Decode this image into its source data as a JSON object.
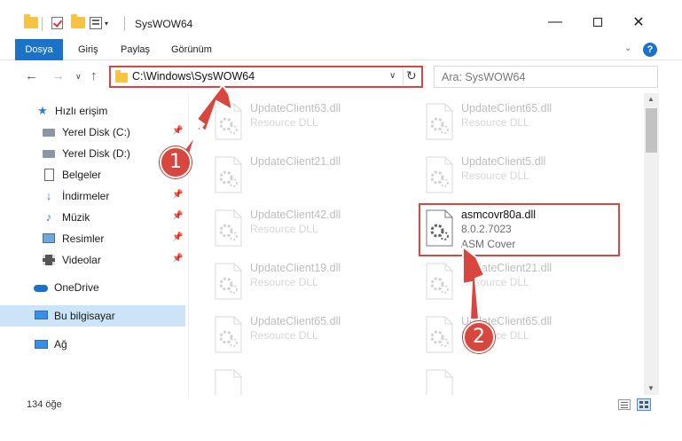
{
  "window": {
    "title": "SysWOW64",
    "minimize_icon": "minimize-icon",
    "maximize_icon": "maximize-icon",
    "close_icon": "close-icon"
  },
  "ribbon": {
    "tabs": [
      {
        "label": "Dosya",
        "active": true
      },
      {
        "label": "Giriş"
      },
      {
        "label": "Paylaş"
      },
      {
        "label": "Görünüm"
      }
    ],
    "help_label": "?"
  },
  "address": {
    "path": "C:\\Windows\\SysWOW64",
    "search_placeholder": "Ara: SysWOW64"
  },
  "sidebar": {
    "items": [
      {
        "label": "Hızlı erişim",
        "icon": "star-icon"
      },
      {
        "label": "Yerel Disk (C:)",
        "icon": "drive-icon",
        "pinned": true
      },
      {
        "label": "Yerel Disk (D:)",
        "icon": "drive-icon"
      },
      {
        "label": "Belgeler",
        "icon": "document-icon"
      },
      {
        "label": "İndirmeler",
        "icon": "download-icon",
        "pinned": true
      },
      {
        "label": "Müzik",
        "icon": "music-icon",
        "pinned": true
      },
      {
        "label": "Resimler",
        "icon": "picture-icon",
        "pinned": true
      },
      {
        "label": "Videolar",
        "icon": "video-icon",
        "pinned": true
      },
      {
        "label": "OneDrive",
        "icon": "cloud-icon"
      },
      {
        "label": "Bu bilgisayar",
        "icon": "computer-icon",
        "selected": true
      },
      {
        "label": "Ağ",
        "icon": "network-icon"
      }
    ]
  },
  "files": [
    {
      "name": "UpdateClient63.dll",
      "desc": "Resource DLL"
    },
    {
      "name": "UpdateClient65.dll",
      "desc": "Resource DLL"
    },
    {
      "name": "UpdateClient21.dll",
      "desc": ""
    },
    {
      "name": "UpdateClient5.dll",
      "desc": "Resource DLL"
    },
    {
      "name": "UpdateClient42.dll",
      "desc": "Resource DLL"
    },
    {
      "name": "asmcovr80a.dll",
      "version": "8.0.2.7023",
      "desc": "ASM Cover"
    },
    {
      "name": "UpdateClient19.dll",
      "desc": "Resource DLL"
    },
    {
      "name": "UpdateClient21.dll",
      "desc": "Resource DLL"
    },
    {
      "name": "UpdateClient65.dll",
      "desc": "Resource DLL"
    },
    {
      "name": "UpdateClient65.dll",
      "desc": "Resource DLL"
    }
  ],
  "status": {
    "item_count": "134 öğe"
  },
  "callouts": [
    "1",
    "2"
  ],
  "colors": {
    "accent": "#1a73c9",
    "highlight": "#d9453f",
    "selection": "#cce4f7",
    "folder": "#f6c342"
  }
}
